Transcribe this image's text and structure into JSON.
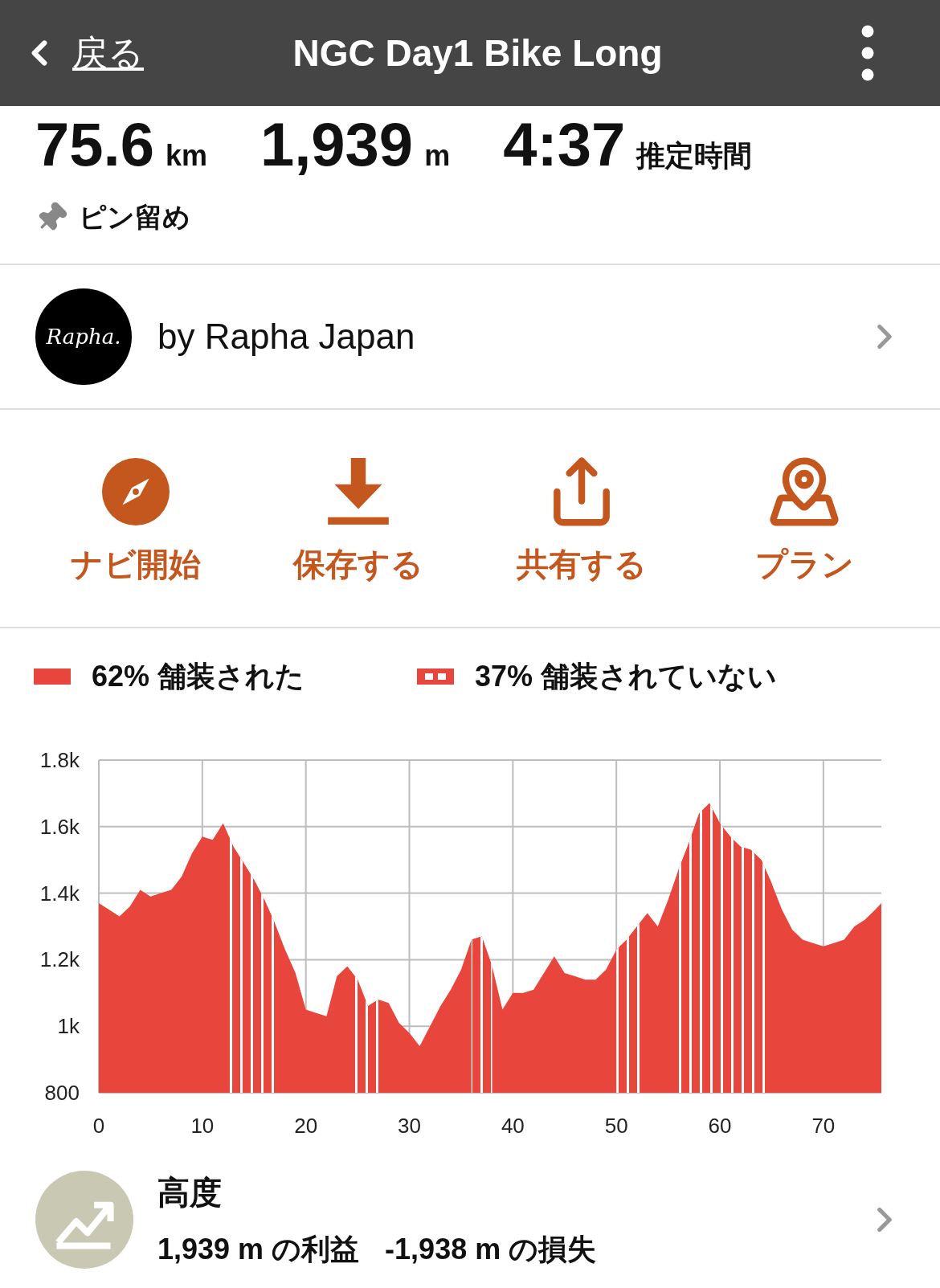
{
  "header": {
    "back_label": "戻る",
    "title": "NGC Day1 Bike Long"
  },
  "stats": [
    {
      "value": "75.6",
      "unit": "km"
    },
    {
      "value": "1,939",
      "unit": "m"
    },
    {
      "value": "4:37",
      "unit": "推定時間"
    }
  ],
  "pin": {
    "label": "ピン留め"
  },
  "author": {
    "logo_text": "Rapha.",
    "label": "by Rapha Japan"
  },
  "actions": [
    {
      "kind": "navigate",
      "label": "ナビ開始"
    },
    {
      "kind": "save",
      "label": "保存する"
    },
    {
      "kind": "share",
      "label": "共有する"
    },
    {
      "kind": "plan",
      "label": "プラン"
    }
  ],
  "surface_legend": [
    {
      "kind": "paved",
      "share": "62%"
    },
    {
      "kind": "unpaved",
      "share": "37%"
    }
  ],
  "chart_data": {
    "type": "area",
    "grid": true,
    "x": [
      0,
      1,
      2,
      3,
      4,
      5,
      6,
      7,
      8,
      9,
      10,
      11,
      12,
      13,
      14,
      15,
      16,
      17,
      18,
      19,
      20,
      21,
      22,
      23,
      24,
      25,
      26,
      27,
      28,
      29,
      30,
      31,
      32,
      33,
      34,
      35,
      36,
      37,
      38,
      39,
      40,
      41,
      42,
      43,
      44,
      45,
      46,
      47,
      48,
      49,
      50,
      51,
      52,
      53,
      54,
      55,
      56,
      57,
      58,
      59,
      60,
      61,
      62,
      63,
      64,
      65,
      66,
      67,
      68,
      69,
      70,
      71,
      72,
      73,
      74,
      75,
      75.6
    ],
    "series": [
      {
        "name": "舗装された",
        "color": "#e8453c",
        "values": [
          1370,
          1350,
          1330,
          1360,
          1410,
          1390,
          1400,
          1410,
          1450,
          1520,
          1570,
          1560,
          1610,
          1540,
          1490,
          1440,
          1380,
          1310,
          1230,
          1160,
          1050,
          1040,
          1030,
          1150,
          1180,
          1140,
          1060,
          1080,
          1070,
          1010,
          980,
          940,
          1000,
          1060,
          1110,
          1170,
          1260,
          1270,
          1180,
          1050,
          1100,
          1100,
          1110,
          1160,
          1210,
          1160,
          1150,
          1140,
          1140,
          1170,
          1230,
          1260,
          1300,
          1340,
          1300,
          1380,
          1470,
          1550,
          1640,
          1670,
          1610,
          1570,
          1540,
          1530,
          1500,
          1430,
          1350,
          1290,
          1260,
          1250,
          1240,
          1250,
          1260,
          1300,
          1320,
          1350,
          1370
        ]
      },
      {
        "name": "舗装されていない",
        "color": "#e8453c",
        "values": [
          null,
          null,
          null,
          null,
          null,
          null,
          null,
          null,
          null,
          null,
          null,
          null,
          1610,
          1540,
          1490,
          1440,
          1380,
          1310,
          null,
          null,
          null,
          null,
          null,
          null,
          1180,
          1140,
          1060,
          1080,
          null,
          null,
          null,
          null,
          null,
          null,
          null,
          null,
          1260,
          1270,
          1180,
          null,
          null,
          null,
          null,
          null,
          null,
          null,
          null,
          null,
          null,
          null,
          1230,
          1260,
          1300,
          1340,
          null,
          null,
          1470,
          1550,
          1640,
          1670,
          1610,
          1570,
          1540,
          1530,
          1500,
          1430,
          null,
          null,
          null,
          null,
          null,
          null,
          null,
          null,
          null,
          null,
          null
        ]
      }
    ],
    "xlim": [
      0,
      75.6
    ],
    "ylim": [
      800,
      1800
    ],
    "xticks": [
      0,
      10,
      20,
      30,
      40,
      50,
      60,
      70
    ],
    "yticks": [
      {
        "value": 800,
        "label": "800"
      },
      {
        "value": 1000,
        "label": "1k"
      },
      {
        "value": 1200,
        "label": "1.2k"
      },
      {
        "value": 1400,
        "label": "1.4k"
      },
      {
        "value": 1600,
        "label": "1.6k"
      },
      {
        "value": 1800,
        "label": "1.8k"
      }
    ]
  },
  "elevation": {
    "title": "高度",
    "gain": "1,939 m の利益",
    "loss": "-1,938 m の損失"
  }
}
